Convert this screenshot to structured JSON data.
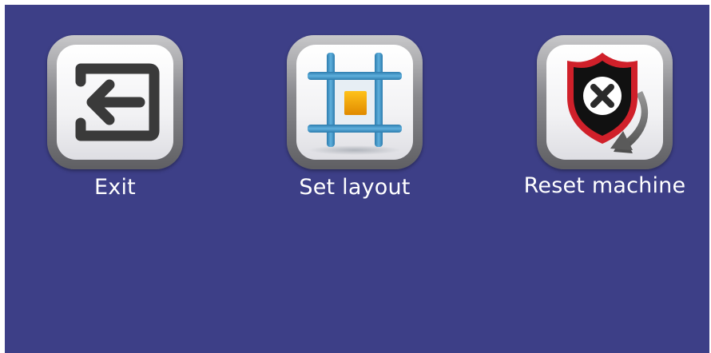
{
  "screen": {
    "background": "#3d3f87"
  },
  "buttons": [
    {
      "label": "Exit",
      "icon": "exit-icon"
    },
    {
      "label": "Set layout",
      "icon": "layout-icon"
    },
    {
      "label": "Reset machine",
      "icon": "reset-shield-icon"
    }
  ],
  "colors": {
    "label": "#ffffff",
    "exit_glyph": "#3a3a3a",
    "layout_grid": "#3f8fc0",
    "layout_square": "#f0a300",
    "shield_red": "#d0202a",
    "shield_black": "#111111",
    "arrow_gray": "#6e6e6e"
  }
}
